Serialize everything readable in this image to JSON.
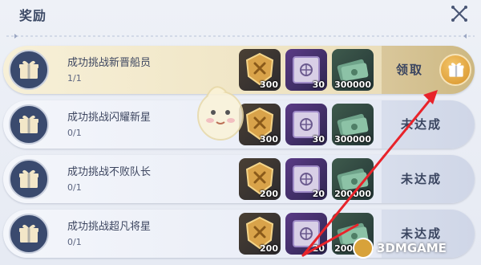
{
  "header": {
    "title": "奖励",
    "close_icon": "crossed-swords-icon"
  },
  "rewards": [
    {
      "name": "成功挑战新晋船员",
      "progress": "1/1",
      "status": "领取",
      "state": "claimable",
      "items": [
        {
          "icon": "gold-badge-icon",
          "qty": "300"
        },
        {
          "icon": "purple-crate-icon",
          "qty": "30"
        },
        {
          "icon": "cash-bundle-icon",
          "qty": "300000"
        }
      ]
    },
    {
      "name": "成功挑战闪耀新星",
      "progress": "0/1",
      "status": "未达成",
      "state": "locked",
      "items": [
        {
          "icon": "gold-badge-icon",
          "qty": "300"
        },
        {
          "icon": "purple-crate-icon",
          "qty": "30"
        },
        {
          "icon": "cash-bundle-icon",
          "qty": "300000"
        }
      ]
    },
    {
      "name": "成功挑战不败队长",
      "progress": "0/1",
      "status": "未达成",
      "state": "locked",
      "items": [
        {
          "icon": "gold-badge-icon",
          "qty": "200"
        },
        {
          "icon": "purple-crate-icon",
          "qty": "20"
        },
        {
          "icon": "cash-bundle-icon",
          "qty": "200000"
        }
      ]
    },
    {
      "name": "成功挑战超凡将星",
      "progress": "0/1",
      "status": "未达成",
      "state": "locked",
      "items": [
        {
          "icon": "gold-badge-icon",
          "qty": "200"
        },
        {
          "icon": "purple-crate-icon",
          "qty": "20"
        },
        {
          "icon": "cash-bundle-icon",
          "qty": "200000"
        }
      ]
    }
  ],
  "watermark": "3DMGAME",
  "colors": {
    "claim_accent": "#e0a23c",
    "annotation_arrow": "#e8232a",
    "gift_disc": "#3a4a6e"
  }
}
